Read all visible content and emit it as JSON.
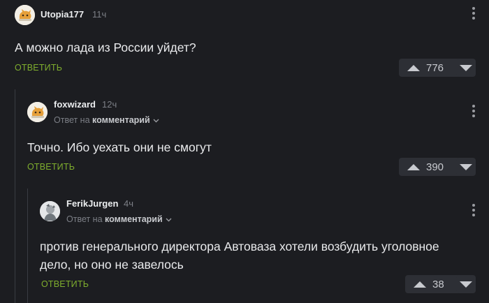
{
  "comments": [
    {
      "username": "Utopia177",
      "time": "11ч",
      "text": "А можно лада из России уйдет?",
      "reply_label": "ответить",
      "votes": "776"
    },
    {
      "username": "foxwizard",
      "time": "12ч",
      "reply_to_prefix": "Ответ на",
      "reply_to_link": "комментарий",
      "text": "Точно. Ибо уехать они не смогут",
      "reply_label": "ответить",
      "votes": "390"
    },
    {
      "username": "FerikJurgen",
      "time": "4ч",
      "reply_to_prefix": "Ответ на",
      "reply_to_link": "комментарий",
      "text_line1": "против генерального директора Автоваза хотели возбудить уголовное",
      "text_line2": "дело, но оно не завелось",
      "reply_label": "ответить",
      "votes": "38"
    }
  ],
  "colors": {
    "background": "#1c1d21",
    "accent_green": "#7fae2e",
    "muted": "#7c7f86",
    "vote_bg": "#2d2f35"
  },
  "icons": [
    "avatar-placeholder",
    "more-vertical-icon",
    "chevron-down-icon",
    "upvote-icon",
    "downvote-icon"
  ]
}
